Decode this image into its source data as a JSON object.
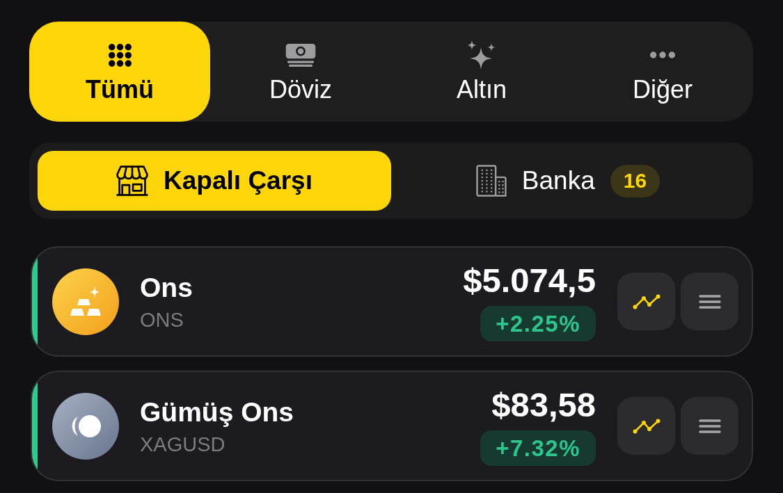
{
  "category_tabs": [
    {
      "label": "Tümü",
      "selected": true
    },
    {
      "label": "Döviz",
      "selected": false
    },
    {
      "label": "Altın",
      "selected": false
    },
    {
      "label": "Diğer",
      "selected": false
    }
  ],
  "source_tabs": [
    {
      "label": "Kapalı Çarşı",
      "selected": true
    },
    {
      "label": "Banka",
      "badge": "16",
      "selected": false
    }
  ],
  "assets": [
    {
      "kind": "gold",
      "name": "Ons",
      "symbol": "ONS",
      "price": "$5.074,5",
      "change": "+2.25%",
      "rising": true
    },
    {
      "kind": "silver",
      "name": "Gümüş Ons",
      "symbol": "XAGUSD",
      "price": "$83,58",
      "change": "+7.32%",
      "rising": true
    }
  ]
}
